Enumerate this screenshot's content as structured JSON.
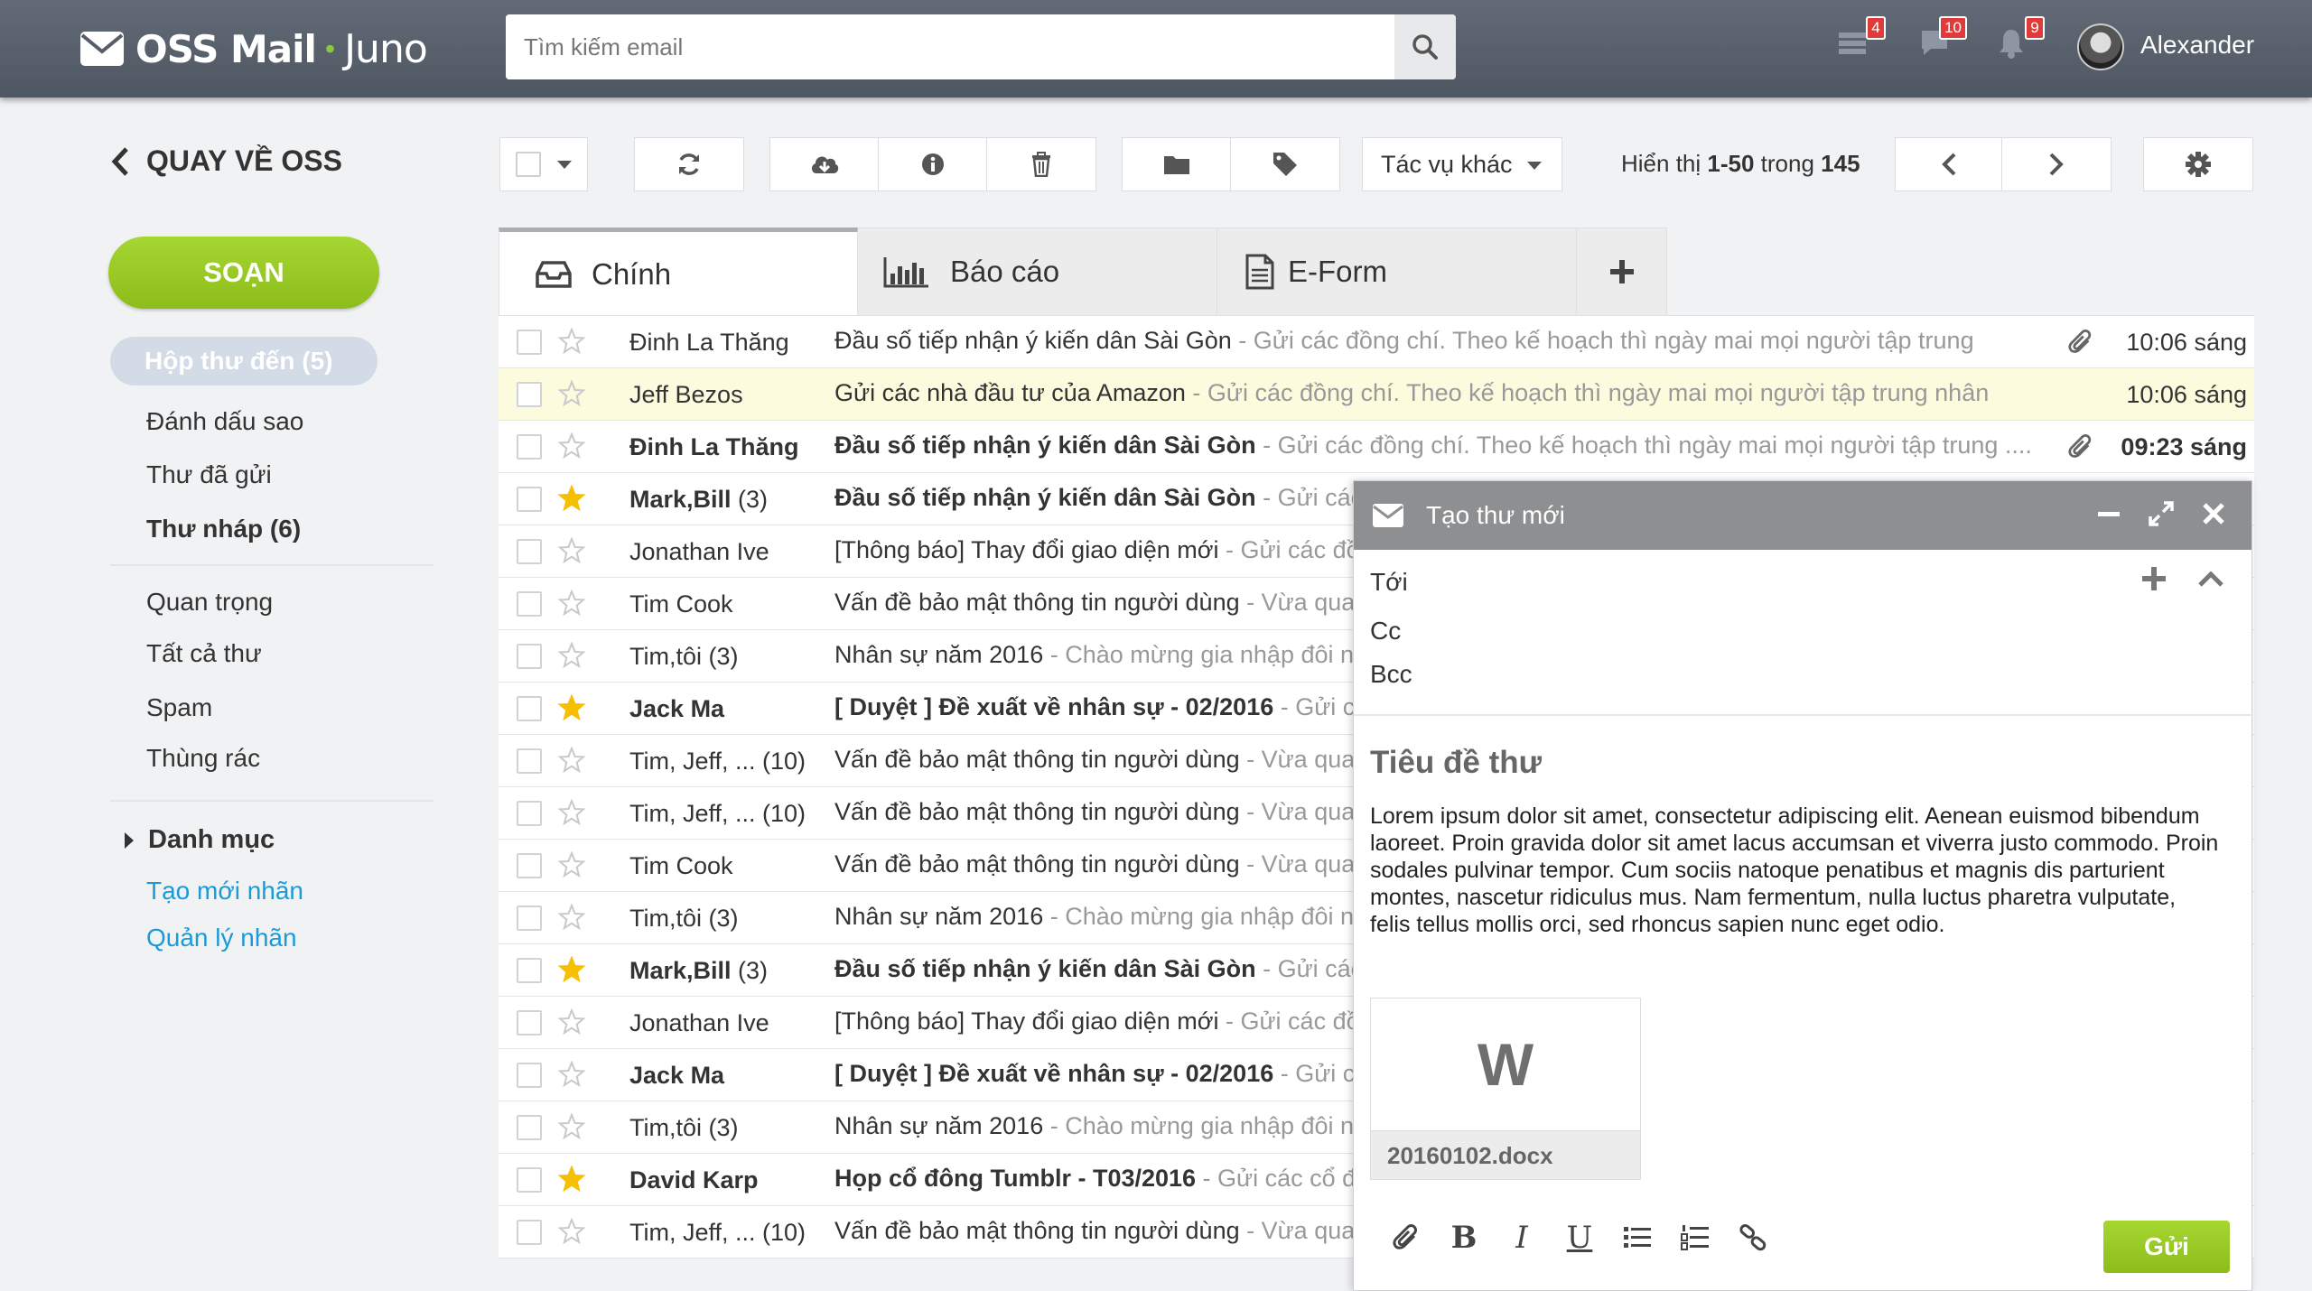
{
  "header": {
    "brand": "OSS Mail",
    "product": "Juno",
    "search_placeholder": "Tìm kiếm email",
    "badges": {
      "tasks": "4",
      "messages": "10",
      "notifications": "9"
    },
    "user_name": "Alexander"
  },
  "sidebar": {
    "back_label": "QUAY VỀ OSS",
    "compose_label": "SOẠN",
    "inbox_label": "Hộp thư đến (5)",
    "items": [
      "Đánh dấu sao",
      "Thư đã gửi",
      "Thư nháp (6)",
      "Quan trọng",
      "Tất cả thư",
      "Spam",
      "Thùng rác"
    ],
    "categories_label": "Danh mục",
    "links": [
      "Tạo mới nhãn",
      "Quản lý nhãn"
    ]
  },
  "toolbar": {
    "more_actions": "Tác vụ khác",
    "count_prefix": "Hiển thị ",
    "count_range": "1-50",
    "count_mid": " trong ",
    "count_total": "145"
  },
  "tabs": [
    {
      "label": "Chính",
      "icon": "inbox-icon"
    },
    {
      "label": "Báo cáo",
      "icon": "bar-chart-icon"
    },
    {
      "label": "E-Form",
      "icon": "document-icon"
    }
  ],
  "emails": [
    {
      "from": "Đinh La Thăng",
      "count": "",
      "subject": "Đầu số tiếp nhận ý kiến dân Sài Gòn",
      "snippet": " - Gửi các đồng chí. Theo kế hoạch thì ngày mai mọi người tập trung",
      "time": "10:06 sáng",
      "starred": false,
      "unread": false,
      "attachment": true,
      "selected": false
    },
    {
      "from": "Jeff Bezos",
      "count": "",
      "subject": "Gửi các nhà đầu tư của Amazon",
      "snippet": " - Gửi các đồng chí. Theo kế hoạch thì ngày mai mọi người tập trung nhân",
      "time": "10:06 sáng",
      "starred": false,
      "unread": false,
      "attachment": false,
      "selected": true
    },
    {
      "from": "Đinh La Thăng",
      "count": "",
      "subject": "Đầu số tiếp nhận ý kiến dân Sài Gòn",
      "snippet": " - Gửi các đồng chí. Theo kế hoạch thì ngày mai mọi người tập trung ....",
      "time": "09:23 sáng",
      "starred": false,
      "unread": true,
      "attachment": true,
      "selected": false
    },
    {
      "from": "Mark,Bill",
      "count": " (3)",
      "subject": "Đầu số tiếp nhận ý kiến dân Sài Gòn",
      "snippet": " - Gửi các",
      "time": "",
      "starred": true,
      "unread": true,
      "attachment": false,
      "selected": false
    },
    {
      "from": "Jonathan Ive",
      "count": "",
      "subject": "[Thông báo] Thay đổi giao diện mới",
      "snippet": " - Gửi các đồ",
      "time": "",
      "starred": false,
      "unread": false,
      "attachment": false,
      "selected": false
    },
    {
      "from": "Tim Cook",
      "count": "",
      "subject": "Vấn đề bảo mật thông tin người dùng",
      "snippet": " - Vừa qua",
      "time": "",
      "starred": false,
      "unread": false,
      "attachment": false,
      "selected": false
    },
    {
      "from": "Tim,tôi",
      "count": " (3)",
      "subject": "Nhân sự năm 2016",
      "snippet": " - Chào mừng gia nhập đôi ngũ",
      "time": "",
      "starred": false,
      "unread": false,
      "attachment": false,
      "selected": false
    },
    {
      "from": "Jack Ma",
      "count": "",
      "subject": "[ Duyệt ] Đề xuất về nhân sự - 02/2016",
      "snippet": " - Gửi các đồ",
      "time": "",
      "starred": true,
      "unread": true,
      "attachment": false,
      "selected": false
    },
    {
      "from": "Tim, Jeff, ...",
      "count": " (10)",
      "subject": "Vấn đề bảo mật thông tin người dùng",
      "snippet": " - Vừa qua",
      "time": "",
      "starred": false,
      "unread": false,
      "attachment": false,
      "selected": false
    },
    {
      "from": "Tim, Jeff, ...",
      "count": " (10)",
      "subject": "Vấn đề bảo mật thông tin người dùng",
      "snippet": " - Vừa qua",
      "time": "",
      "starred": false,
      "unread": false,
      "attachment": false,
      "selected": false
    },
    {
      "from": "Tim Cook",
      "count": "",
      "subject": "Vấn đề bảo mật thông tin người dùng",
      "snippet": " - Vừa qua",
      "time": "",
      "starred": false,
      "unread": false,
      "attachment": false,
      "selected": false
    },
    {
      "from": "Tim,tôi",
      "count": " (3)",
      "subject": "Nhân sự năm 2016",
      "snippet": " - Chào mừng gia nhập đôi ngũ",
      "time": "",
      "starred": false,
      "unread": false,
      "attachment": false,
      "selected": false
    },
    {
      "from": "Mark,Bill",
      "count": " (3)",
      "subject": "Đầu số tiếp nhận ý kiến dân Sài Gòn",
      "snippet": " - Gửi các",
      "time": "",
      "starred": true,
      "unread": true,
      "attachment": false,
      "selected": false
    },
    {
      "from": "Jonathan Ive",
      "count": "",
      "subject": "[Thông báo] Thay đổi giao diện mới",
      "snippet": " - Gửi các đồ",
      "time": "",
      "starred": false,
      "unread": false,
      "attachment": false,
      "selected": false
    },
    {
      "from": "Jack Ma",
      "count": "",
      "subject": "[ Duyệt ] Đề xuất về nhân sự - 02/2016",
      "snippet": " - Gửi các",
      "time": "",
      "starred": false,
      "unread": true,
      "attachment": false,
      "selected": false
    },
    {
      "from": "Tim,tôi",
      "count": " (3)",
      "subject": "Nhân sự năm 2016",
      "snippet": " - Chào mừng gia nhập đôi ngũ",
      "time": "",
      "starred": false,
      "unread": false,
      "attachment": false,
      "selected": false
    },
    {
      "from": "David Karp",
      "count": "",
      "subject": "Họp cổ đông Tumblr - T03/2016",
      "snippet": " - Gửi các cổ đô",
      "time": "",
      "starred": true,
      "unread": true,
      "attachment": false,
      "selected": false
    },
    {
      "from": "Tim, Jeff, ...",
      "count": " (10)",
      "subject": "Vấn đề bảo mật thông tin người dùng",
      "snippet": " - Vừa qua",
      "time": "",
      "starred": false,
      "unread": false,
      "attachment": false,
      "selected": false
    }
  ],
  "compose": {
    "title": "Tạo thư mới",
    "to_label": "Tới",
    "cc_label": "Cc",
    "bcc_label": "Bcc",
    "subject": "Tiêu đề thư",
    "body": "Lorem ipsum dolor sit amet, consectetur adipiscing elit. Aenean euismod bibendum laoreet. Proin gravida dolor sit amet lacus accumsan et viverra justo commodo. Proin sodales pulvinar tempor. Cum sociis natoque penatibus et magnis dis parturient montes, nascetur ridiculus mus. Nam fermentum, nulla luctus pharetra vulputate, felis tellus mollis orci, sed rhoncus sapien nunc eget odio.",
    "attachment_letter": "W",
    "attachment_name": "20160102.docx",
    "send_label": "Gửi"
  },
  "colors": {
    "accent_green": "#9acb26",
    "header_bg": "#59616c",
    "link_blue": "#1a9bd7",
    "star_gold": "#f6c000",
    "badge_red": "#e03b3b"
  }
}
